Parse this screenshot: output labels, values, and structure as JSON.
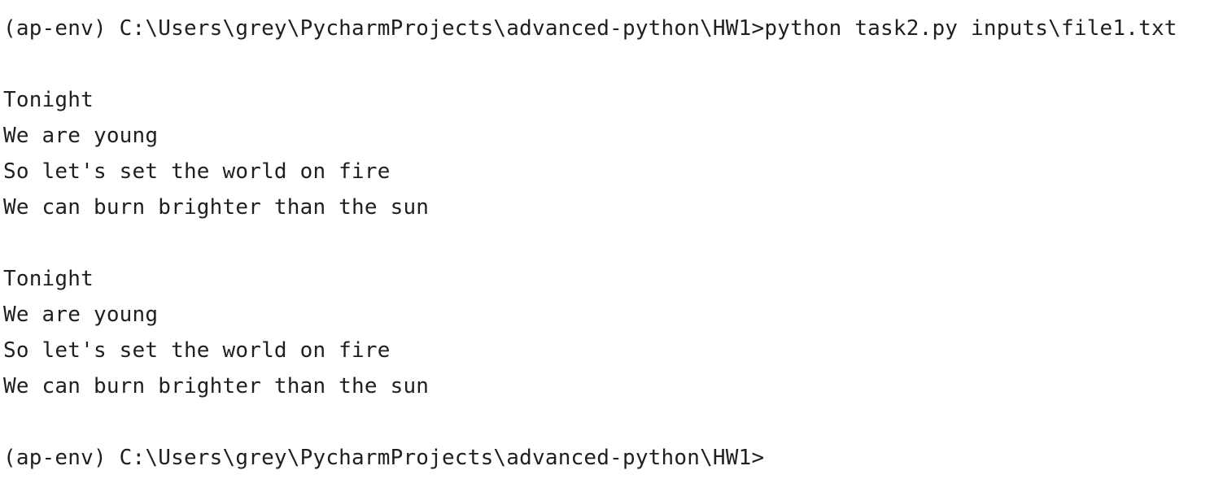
{
  "terminal": {
    "command_line": {
      "prompt": "(ap-env) C:\\Users\\grey\\PycharmProjects\\advanced-python\\HW1>",
      "command": "python task2.py inputs\\file1.txt"
    },
    "output": [
      "Tonight",
      "We are young",
      "So let's set the world on fire",
      "We can burn brighter than the sun",
      "Tonight",
      "We are young",
      "So let's set the world on fire",
      "We can burn brighter than the sun"
    ],
    "final_prompt": "(ap-env) C:\\Users\\grey\\PycharmProjects\\advanced-python\\HW1>"
  }
}
